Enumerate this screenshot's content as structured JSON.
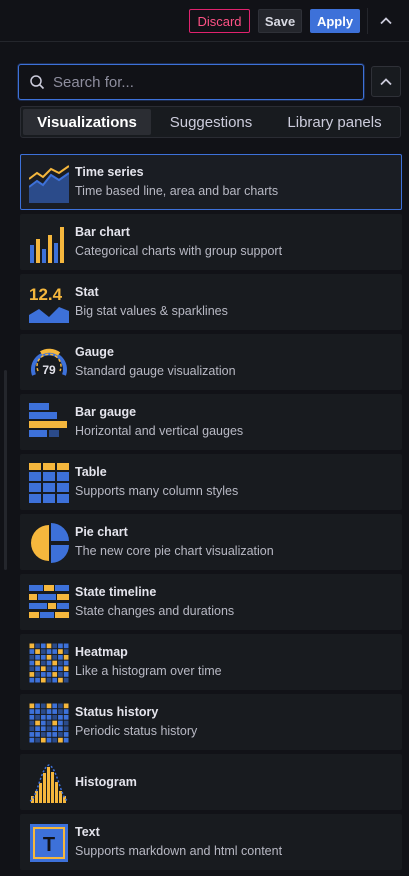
{
  "toolbar": {
    "discard_label": "Discard",
    "save_label": "Save",
    "apply_label": "Apply"
  },
  "search": {
    "placeholder": "Search for...",
    "value": ""
  },
  "tabs": [
    {
      "label": "Visualizations",
      "active": true
    },
    {
      "label": "Suggestions",
      "active": false
    },
    {
      "label": "Library panels",
      "active": false
    }
  ],
  "visualizations": [
    {
      "title": "Time series",
      "description": "Time based line, area and bar charts",
      "icon": "time-series-icon",
      "selected": true
    },
    {
      "title": "Bar chart",
      "description": "Categorical charts with group support",
      "icon": "bar-chart-icon"
    },
    {
      "title": "Stat",
      "description": "Big stat values & sparklines",
      "icon": "stat-icon",
      "icon_text": "12.4"
    },
    {
      "title": "Gauge",
      "description": "Standard gauge visualization",
      "icon": "gauge-icon",
      "icon_text": "79"
    },
    {
      "title": "Bar gauge",
      "description": "Horizontal and vertical gauges",
      "icon": "bar-gauge-icon"
    },
    {
      "title": "Table",
      "description": "Supports many column styles",
      "icon": "table-icon"
    },
    {
      "title": "Pie chart",
      "description": "The new core pie chart visualization",
      "icon": "pie-chart-icon"
    },
    {
      "title": "State timeline",
      "description": "State changes and durations",
      "icon": "state-timeline-icon"
    },
    {
      "title": "Heatmap",
      "description": "Like a histogram over time",
      "icon": "heatmap-icon"
    },
    {
      "title": "Status history",
      "description": "Periodic status history",
      "icon": "status-history-icon"
    },
    {
      "title": "Histogram",
      "description": "",
      "icon": "histogram-icon"
    },
    {
      "title": "Text",
      "description": "Supports markdown and html content",
      "icon": "text-icon",
      "icon_text": "T"
    }
  ],
  "colors": {
    "accent": "#3d71d9",
    "yellow": "#f5b73d",
    "blue": "#3d71d9",
    "discard": "#e0226e"
  }
}
